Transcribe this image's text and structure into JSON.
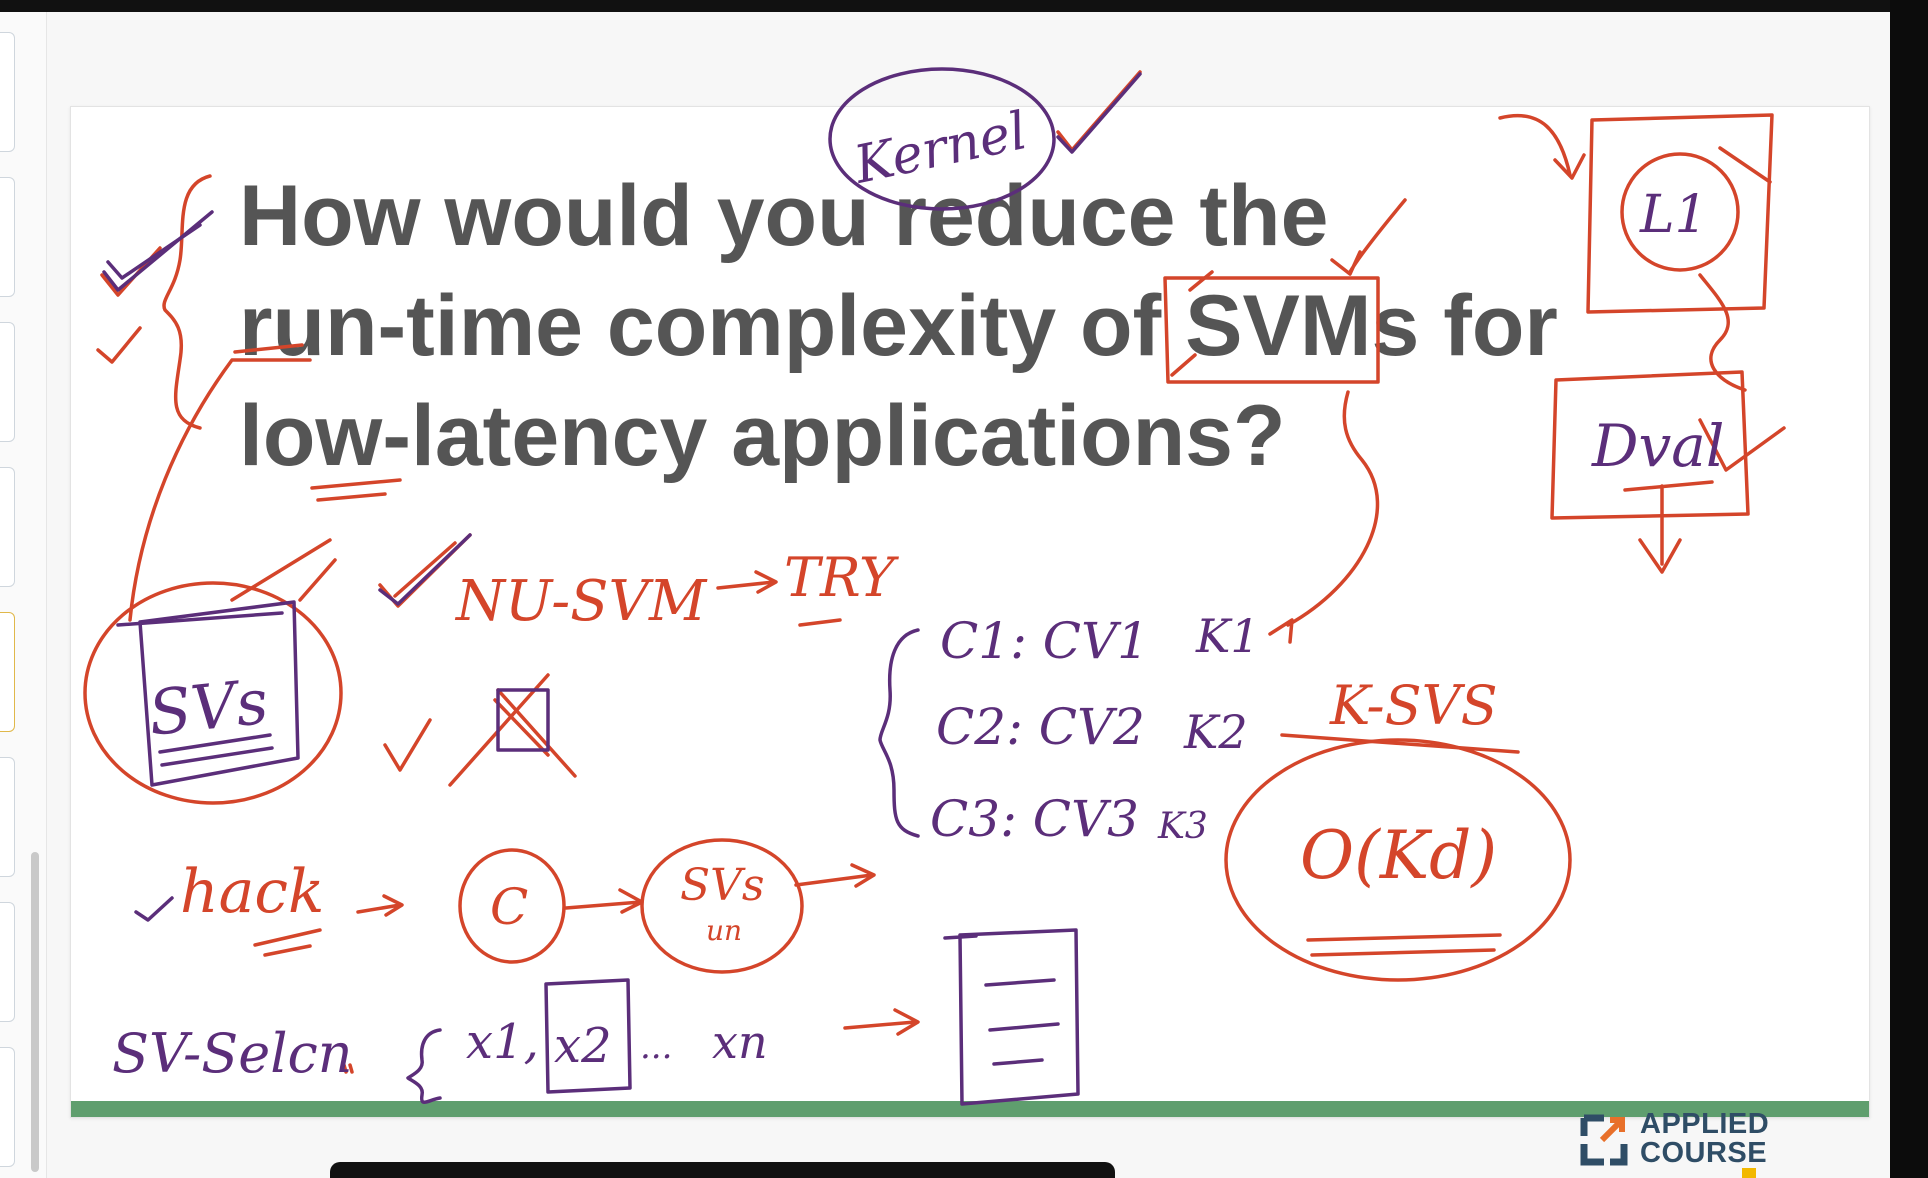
{
  "slide": {
    "title_lines": [
      "How would you reduce the",
      "run-time complexity of SVMs for",
      "low-latency applications?"
    ]
  },
  "annotations": {
    "kernel": "Kernel",
    "l1": "L1",
    "dval": "Dval",
    "svs_box": "SVs",
    "nu_svm": "NU-SVM",
    "try": "TRY",
    "hack": "hack",
    "c_circle": "C",
    "svs_circle": "SVs",
    "svs_circle_sub": "un",
    "c1_row": "C1: CV1",
    "c2_row": "C2: CV2",
    "c3_row": "C3: CV3",
    "k1": "K1",
    "k2": "K2",
    "k3": "K3",
    "k_svs": "K-SVS",
    "o_kd": "O(Kd)",
    "sv_selection": "SV-Selcn",
    "x1": "x1,",
    "x2": "x2",
    "dots": "...",
    "xn": "xn"
  },
  "logo": {
    "line1": "APPLIED",
    "line2": "COURSE",
    "icon": "applied-course-logo-icon"
  },
  "colors": {
    "ink_red": "#d4452a",
    "ink_purple": "#5b2e7a",
    "title_gray": "#555555",
    "green_bar": "#5f9e6e",
    "logo_blue": "#2f4d66",
    "logo_orange": "#e8702a"
  }
}
